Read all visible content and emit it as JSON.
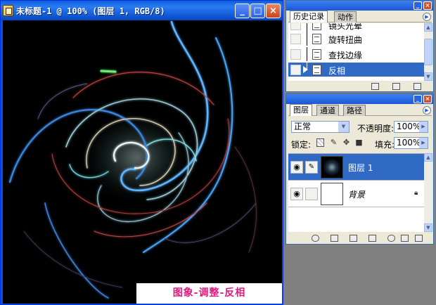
{
  "document": {
    "title": "未标题-1 @ 100% (图层 1, RGB/8)",
    "minimize": "_",
    "maximize": "□",
    "close": "×",
    "caption": "图象-调整-反相"
  },
  "history_palette": {
    "tabs": [
      "历史记录",
      "动作"
    ],
    "items": [
      {
        "label": "镜头光晕"
      },
      {
        "label": "旋转扭曲"
      },
      {
        "label": "查找边缘"
      },
      {
        "label": "反相",
        "selected": true
      }
    ]
  },
  "layers_palette": {
    "tabs": [
      "图层",
      "通道",
      "路径"
    ],
    "blend_mode": "正常",
    "opacity_label": "不透明度:",
    "opacity": "100%",
    "lock_label": "锁定:",
    "fill_label": "填充:",
    "fill": "100%",
    "layers": [
      {
        "name": "图层 1",
        "selected": true
      },
      {
        "name": "背景",
        "locked": true
      }
    ]
  },
  "colors": {
    "titlebar": "#0a5ddc",
    "selection": "#316ac5",
    "caption_text": "#e0187f"
  }
}
